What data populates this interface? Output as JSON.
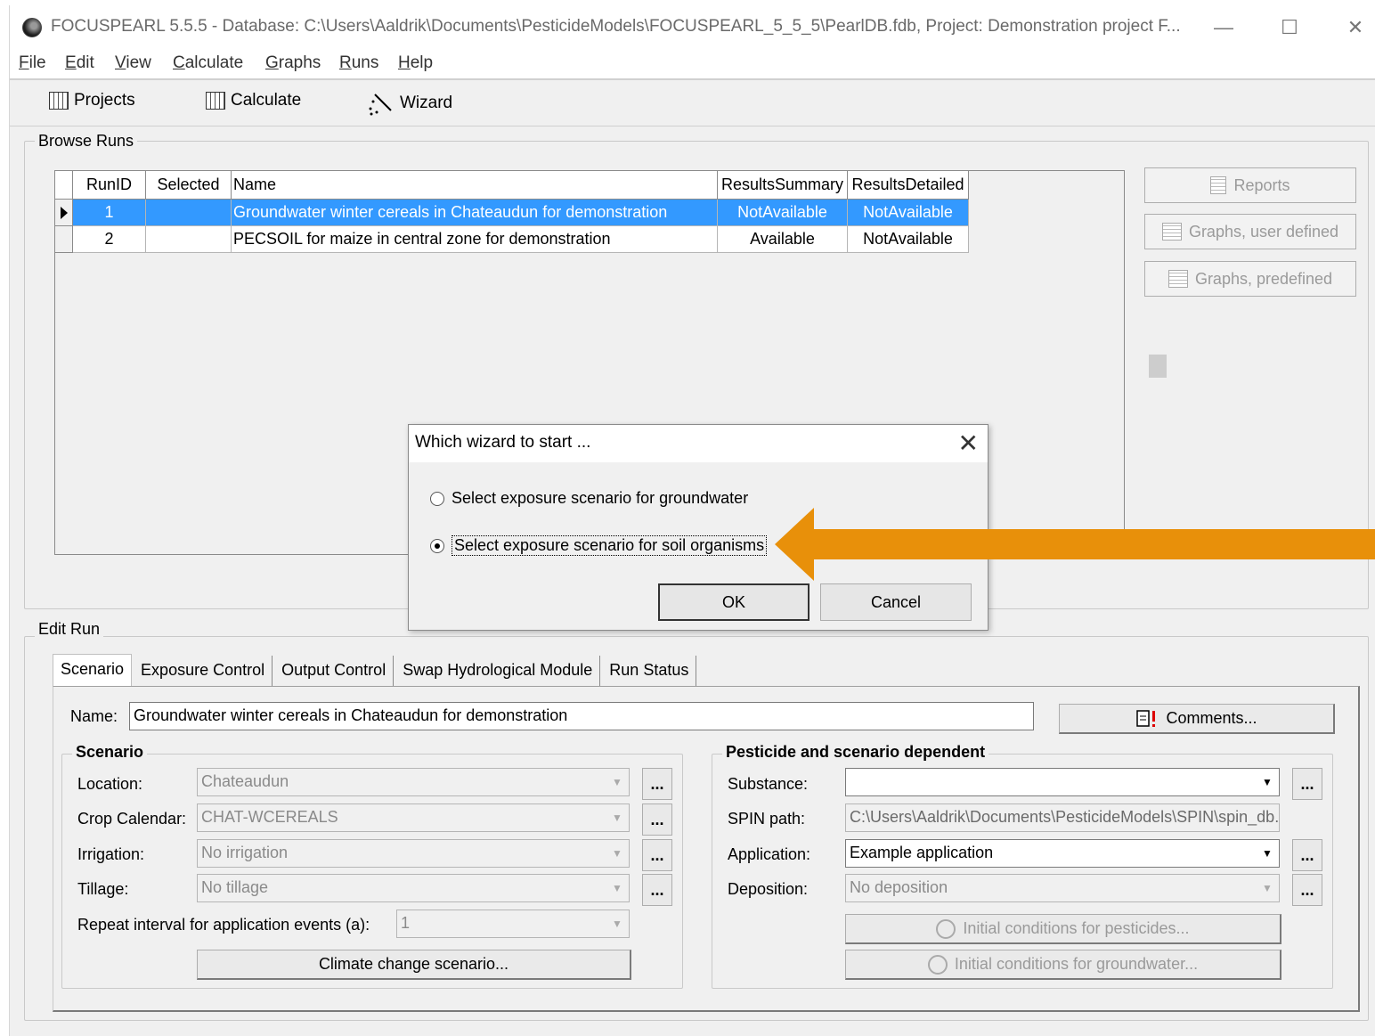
{
  "window": {
    "title": "FOCUSPEARL 5.5.5 - Database: C:\\Users\\Aaldrik\\Documents\\PesticideModels\\FOCUSPEARL_5_5_5\\PearlDB.fdb, Project: Demonstration project F...",
    "minimize": "—",
    "maximize": "☐",
    "close": "✕"
  },
  "menu": [
    {
      "u": "F",
      "rest": "ile"
    },
    {
      "u": "E",
      "rest": "dit"
    },
    {
      "u": "V",
      "rest": "iew"
    },
    {
      "u": "C",
      "rest": "alculate"
    },
    {
      "u": "G",
      "rest": "raphs"
    },
    {
      "u": "R",
      "rest": "uns"
    },
    {
      "u": "H",
      "rest": "elp"
    }
  ],
  "toolbar": {
    "projects": "Projects",
    "calculate": "Calculate",
    "wizard": "Wizard"
  },
  "browse": {
    "label": "Browse Runs",
    "columns": [
      "RunID",
      "Selected",
      "Name",
      "ResultsSummary",
      "ResultsDetailed"
    ],
    "rows": [
      {
        "id": "1",
        "selected": "",
        "name": "Groundwater winter cereals in Chateaudun for demonstration",
        "summary": "NotAvailable",
        "detailed": "NotAvailable"
      },
      {
        "id": "2",
        "selected": "",
        "name": "PECSOIL for maize in central zone for demonstration",
        "summary": "Available",
        "detailed": "NotAvailable"
      }
    ],
    "buttons": {
      "reports": "Reports",
      "graphs_user": "Graphs, user defined",
      "graphs_pre": "Graphs, predefined"
    }
  },
  "dialog": {
    "title": "Which wizard to start ...",
    "close": "✕",
    "option1": "Select exposure scenario for groundwater",
    "option2": "Select exposure scenario for soil organisms",
    "ok": "OK",
    "cancel": "Cancel"
  },
  "annotation": {
    "arrow_color": "#e8900a"
  },
  "edit": {
    "label": "Edit Run",
    "tabs": [
      "Scenario",
      "Exposure Control",
      "Output Control",
      "Swap Hydrological Module",
      "Run Status"
    ],
    "name_label": "Name:",
    "name_value": "Groundwater winter cereals in Chateaudun for demonstration",
    "comments": "Comments...",
    "scenario": {
      "label": "Scenario",
      "location_label": "Location:",
      "location": "Chateaudun",
      "crop_label": "Crop Calendar:",
      "crop": "CHAT-WCEREALS",
      "irrigation_label": "Irrigation:",
      "irrigation": "No irrigation",
      "tillage_label": "Tillage:",
      "tillage": "No tillage",
      "repeat_label": "Repeat interval for application events (a):",
      "repeat": "1",
      "climate_btn": "Climate change scenario..."
    },
    "pesticide": {
      "label": "Pesticide and scenario dependent",
      "substance_label": "Substance:",
      "substance": "",
      "spin_label": "SPIN path:",
      "spin": "C:\\Users\\Aaldrik\\Documents\\PesticideModels\\SPIN\\spin_db.fi",
      "application_label": "Application:",
      "application": "Example application",
      "deposition_label": "Deposition:",
      "deposition": "No deposition",
      "init_pest": "Initial conditions for pesticides...",
      "init_gw": "Initial conditions for groundwater..."
    },
    "dots": "..."
  }
}
